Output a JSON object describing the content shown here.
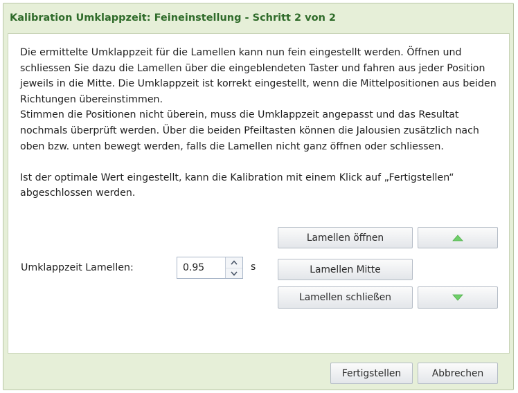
{
  "dialog": {
    "title": "Kalibration Umklappzeit: Feineinstellung - Schritt 2 von 2"
  },
  "description": {
    "paragraph1": "Die ermittelte Umklappzeit für die Lamellen kann nun fein eingestellt werden. Öffnen und schliessen Sie dazu die Lamellen über die eingeblendeten Taster und fahren aus jeder Position jeweils in die Mitte. Die Umklappzeit ist korrekt eingestellt, wenn die Mittelpositionen aus beiden Richtungen übereinstimmen.",
    "paragraph2": "Stimmen die Positionen nicht überein, muss die Umklappzeit angepasst und das Resultat nochmals überprüft werden. Über die beiden Pfeiltasten können die Jalousien zusätzlich nach oben bzw. unten bewegt werden, falls die Lamellen nicht ganz öffnen oder schliessen.",
    "paragraph3": "Ist der optimale Wert eingestellt, kann die Kalibration mit einem Klick auf „Fertigstellen“ abgeschlossen werden."
  },
  "settings": {
    "label": "Umklappzeit Lamellen:",
    "value": "0.95",
    "unit": "s"
  },
  "controls": {
    "open_label": "Lamellen öffnen",
    "middle_label": "Lamellen Mitte",
    "close_label": "Lamellen schließen",
    "up_icon": "triangle-up-icon",
    "down_icon": "triangle-down-icon",
    "arrow_color": "#6fcf6a"
  },
  "footer": {
    "finish_label": "Fertigstellen",
    "cancel_label": "Abbrechen"
  },
  "colors": {
    "title": "#2f6b2a",
    "dialog_background": "#e6efd8"
  }
}
